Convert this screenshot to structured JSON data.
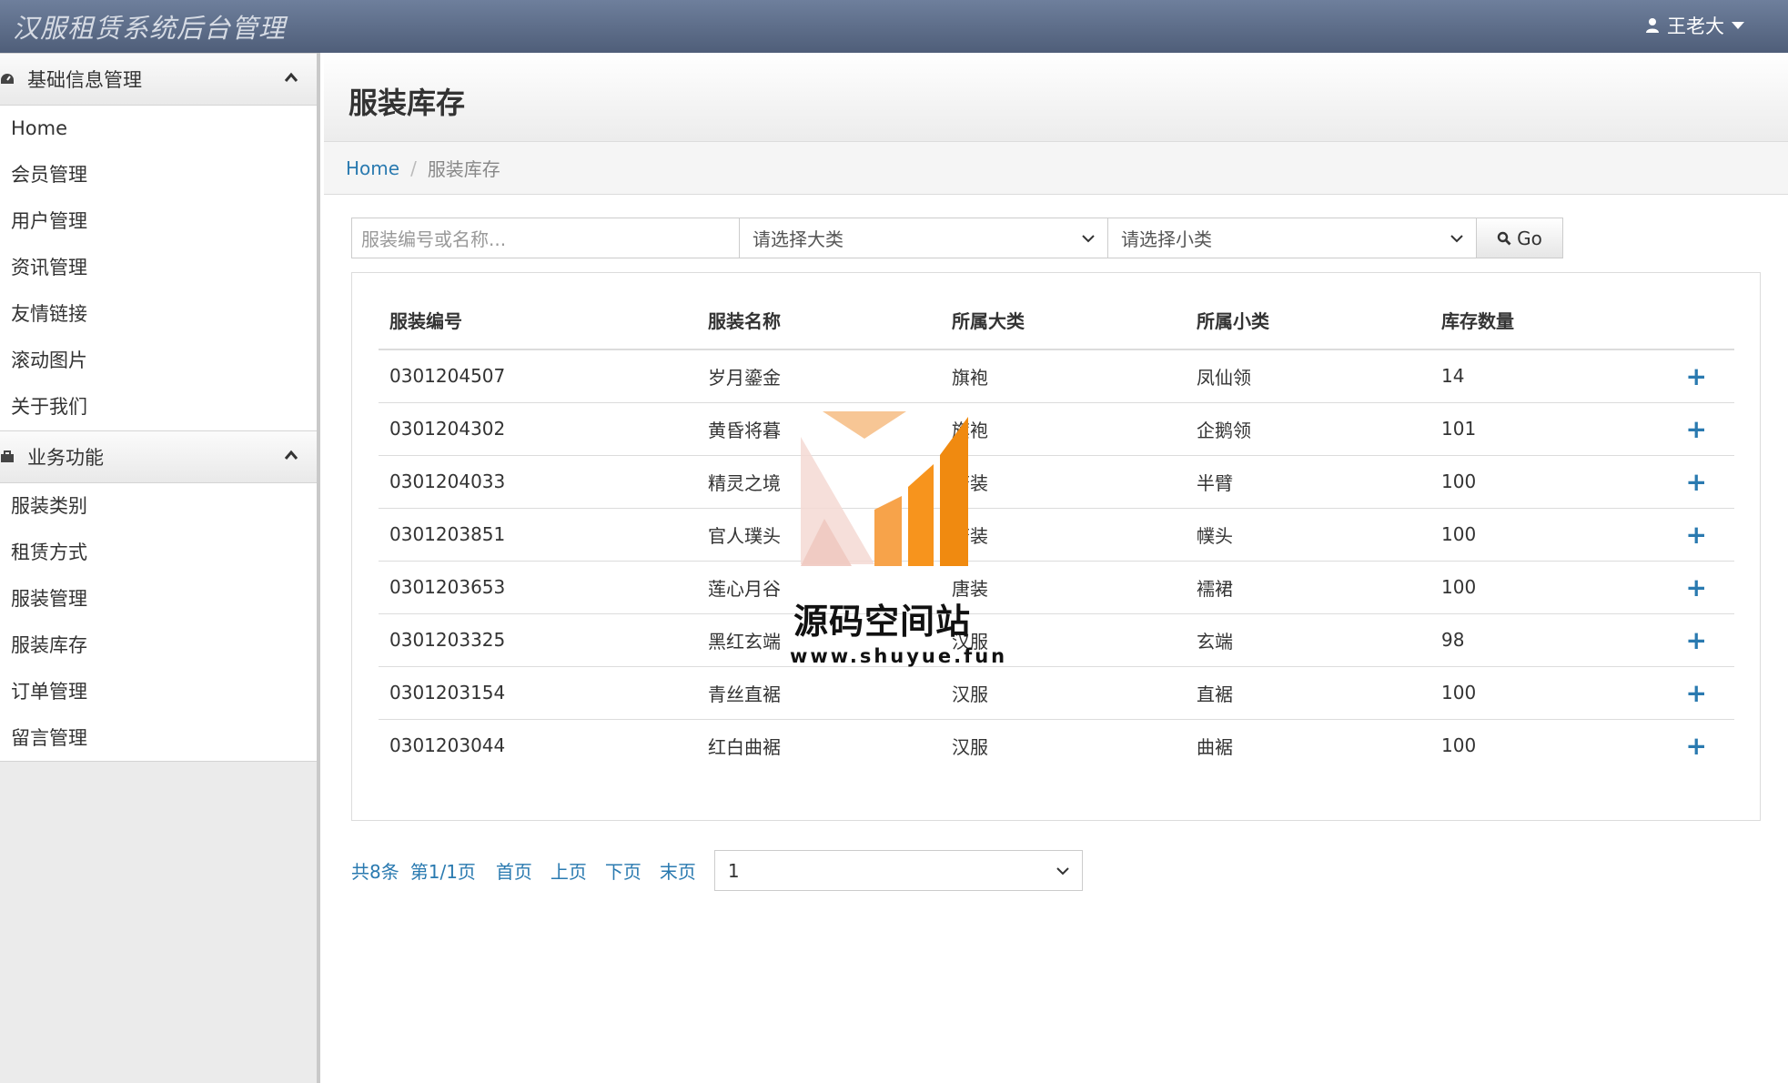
{
  "app": {
    "title": "汉服租赁系统后台管理"
  },
  "user": {
    "name": "王老大"
  },
  "sidebar": {
    "sections": [
      {
        "title": "基础信息管理",
        "items": [
          "Home",
          "会员管理",
          "用户管理",
          "资讯管理",
          "友情链接",
          "滚动图片",
          "关于我们"
        ]
      },
      {
        "title": "业务功能",
        "items": [
          "服装类别",
          "租赁方式",
          "服装管理",
          "服装库存",
          "订单管理",
          "留言管理"
        ]
      }
    ]
  },
  "page": {
    "title": "服装库存"
  },
  "breadcrumb": {
    "home": "Home",
    "current": "服装库存"
  },
  "filter": {
    "search_placeholder": "服装编号或名称...",
    "category_placeholder": "请选择大类",
    "subcategory_placeholder": "请选择小类",
    "go_label": "Go"
  },
  "table": {
    "headers": [
      "服装编号",
      "服装名称",
      "所属大类",
      "所属小类",
      "库存数量"
    ],
    "rows": [
      [
        "0301204507",
        "岁月鎏金",
        "旗袍",
        "凤仙领",
        "14"
      ],
      [
        "0301204302",
        "黄昏将暮",
        "旗袍",
        "企鹅领",
        "101"
      ],
      [
        "0301204033",
        "精灵之境",
        "唐装",
        "半臂",
        "100"
      ],
      [
        "0301203851",
        "官人璞头",
        "唐装",
        "幞头",
        "100"
      ],
      [
        "0301203653",
        "莲心月谷",
        "唐装",
        "襦裙",
        "100"
      ],
      [
        "0301203325",
        "黑红玄端",
        "汉服",
        "玄端",
        "98"
      ],
      [
        "0301203154",
        "青丝直裾",
        "汉服",
        "直裾",
        "100"
      ],
      [
        "0301203044",
        "红白曲裾",
        "汉服",
        "曲裾",
        "100"
      ]
    ],
    "action_symbol": "+"
  },
  "pager": {
    "total": "共8条",
    "page_info": "第1/1页",
    "first": "首页",
    "prev": "上页",
    "next": "下页",
    "last": "末页",
    "current_page": "1"
  },
  "watermark": {
    "text": "源码空间站",
    "url": "www.shuyue.fun"
  },
  "colors": {
    "topbar": "#5d6d89",
    "link": "#2a7ab0",
    "watermark_orange": "#f7941d"
  }
}
